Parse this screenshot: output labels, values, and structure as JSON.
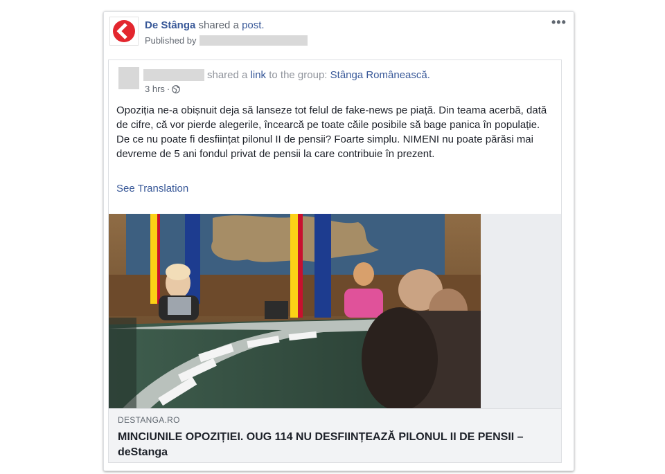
{
  "post": {
    "page_name": "De Stânga",
    "shared_text": "shared a",
    "post_link": "post.",
    "published_by": "Published by",
    "page_logo_icon": "de-stanga-logo-icon",
    "more_icon": "more-options-icon",
    "more_label": "•••"
  },
  "inner": {
    "shared_text": "shared a",
    "link_text": "link",
    "to_group_text": "to the group:",
    "group_name": "Stânga Românească.",
    "time": "3 hrs",
    "dot": "·",
    "privacy_icon": "globe-icon",
    "body_paragraph_1": "Opoziția ne-a obișnuit deja să lanseze tot felul de fake-news pe piață. Din teama acerbă, dată de cifre, că vor pierde alegerile, încearcă pe toate căile posibile să bage panica în populație.",
    "body_paragraph_2": "De ce nu poate fi desființat pilonul II de pensii? Foarte simplu. NIMENI nu poate părăsi mai devreme de 5 ani fondul privat de pensii la care contribuie în prezent.",
    "see_translation": "See Translation"
  },
  "link_preview": {
    "domain": "DESTANGA.RO",
    "headline": "MINCIUNILE OPOZIȚIEI. OUG 114 NU DESFIINȚEAZĂ PILONUL II DE PENSII – deStanga"
  },
  "colors": {
    "link": "#385898",
    "muted": "#616770",
    "logo_red": "#e3262e"
  }
}
